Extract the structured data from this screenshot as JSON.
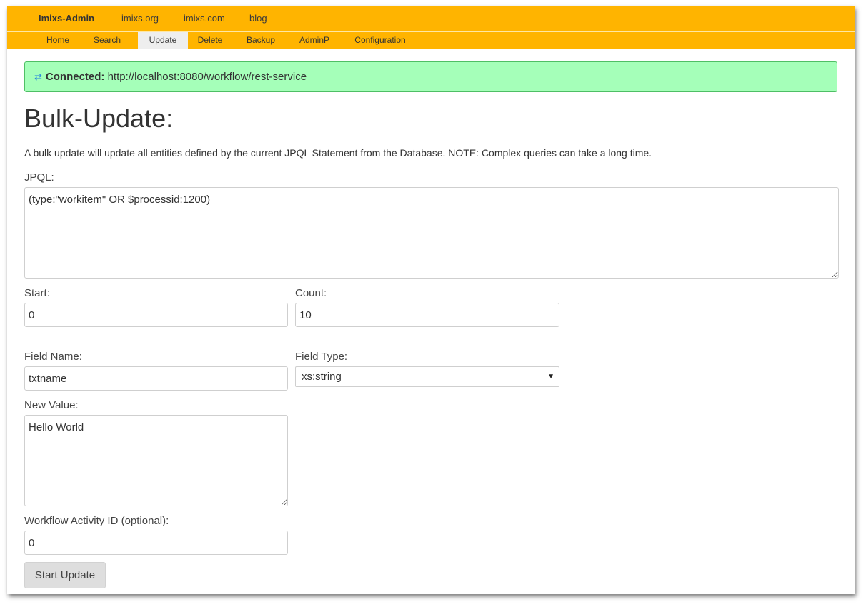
{
  "topnav": {
    "brand": "Imixs-Admin",
    "links": [
      "imixs.org",
      "imixs.com",
      "blog"
    ]
  },
  "subnav": {
    "tabs": [
      "Home",
      "Search",
      "Update",
      "Delete",
      "Backup",
      "AdminP",
      "Configuration"
    ],
    "active": "Update"
  },
  "alert": {
    "label": "Connected:",
    "url": "http://localhost:8080/workflow/rest-service"
  },
  "page": {
    "title": "Bulk-Update:",
    "description": "A bulk update will update all entities defined by the current JPQL Statement from the Database. NOTE: Complex queries can take a long time."
  },
  "form": {
    "jpql_label": "JPQL:",
    "jpql_value": "(type:\"workitem\" OR $processid:1200)",
    "start_label": "Start:",
    "start_value": "0",
    "count_label": "Count:",
    "count_value": "10",
    "field_name_label": "Field Name:",
    "field_name_value": "txtname",
    "field_type_label": "Field Type:",
    "field_type_value": "xs:string",
    "new_value_label": "New Value:",
    "new_value_value": "Hello World",
    "activity_label": "Workflow Activity ID (optional):",
    "activity_value": "0",
    "submit_label": "Start Update"
  },
  "colors": {
    "navbar": "#ffb400",
    "alert_bg": "#a5ffb9",
    "alert_border": "#4fbf65",
    "active_tab": "#eeeeee"
  }
}
